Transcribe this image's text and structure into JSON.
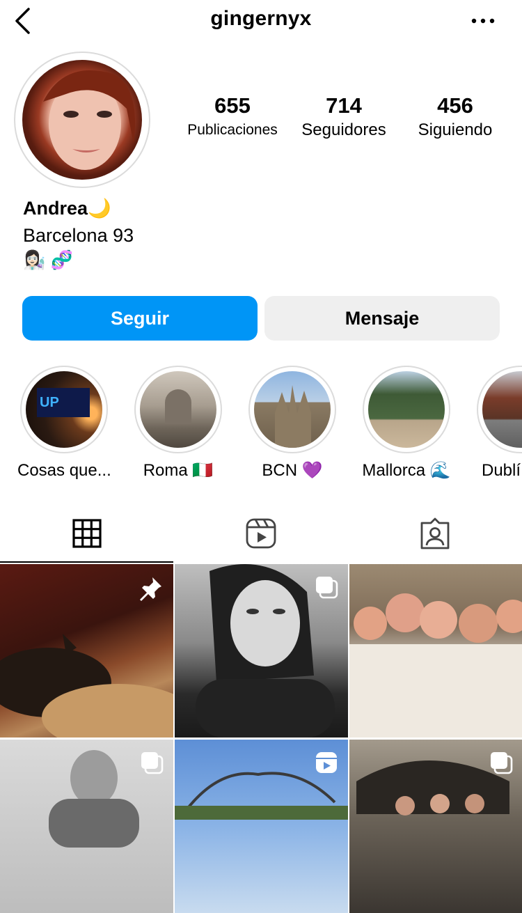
{
  "header": {
    "username": "gingernyx"
  },
  "stats": [
    {
      "value": "655",
      "label": "Publicaciones"
    },
    {
      "value": "714",
      "label": "Seguidores"
    },
    {
      "value": "456",
      "label": "Siguiendo"
    }
  ],
  "bio": {
    "name": "Andrea🌙",
    "location": "Barcelona 93",
    "emojis": "👩🏻‍🔬 🧬"
  },
  "buttons": {
    "follow": "Seguir",
    "message": "Mensaje"
  },
  "highlights": [
    {
      "label": "Cosas que..."
    },
    {
      "label": "Roma 🇮🇹"
    },
    {
      "label": "BCN 💜"
    },
    {
      "label": "Mallorca 🌊"
    },
    {
      "label": "Dublí"
    }
  ],
  "tabs": [
    {
      "icon": "grid-icon",
      "active": true
    },
    {
      "icon": "reels-icon",
      "active": false
    },
    {
      "icon": "tagged-icon",
      "active": false
    }
  ],
  "posts": [
    {
      "badge": "pin-icon"
    },
    {
      "badge": "multiple-photos-icon"
    },
    {
      "badge": ""
    },
    {
      "badge": "multiple-photos-icon"
    },
    {
      "badge": "reel-icon"
    },
    {
      "badge": "multiple-photos-icon"
    }
  ],
  "colors": {
    "accent": "#0095f6",
    "secondary_button": "#efefef",
    "ring": "#dbdbdb"
  }
}
